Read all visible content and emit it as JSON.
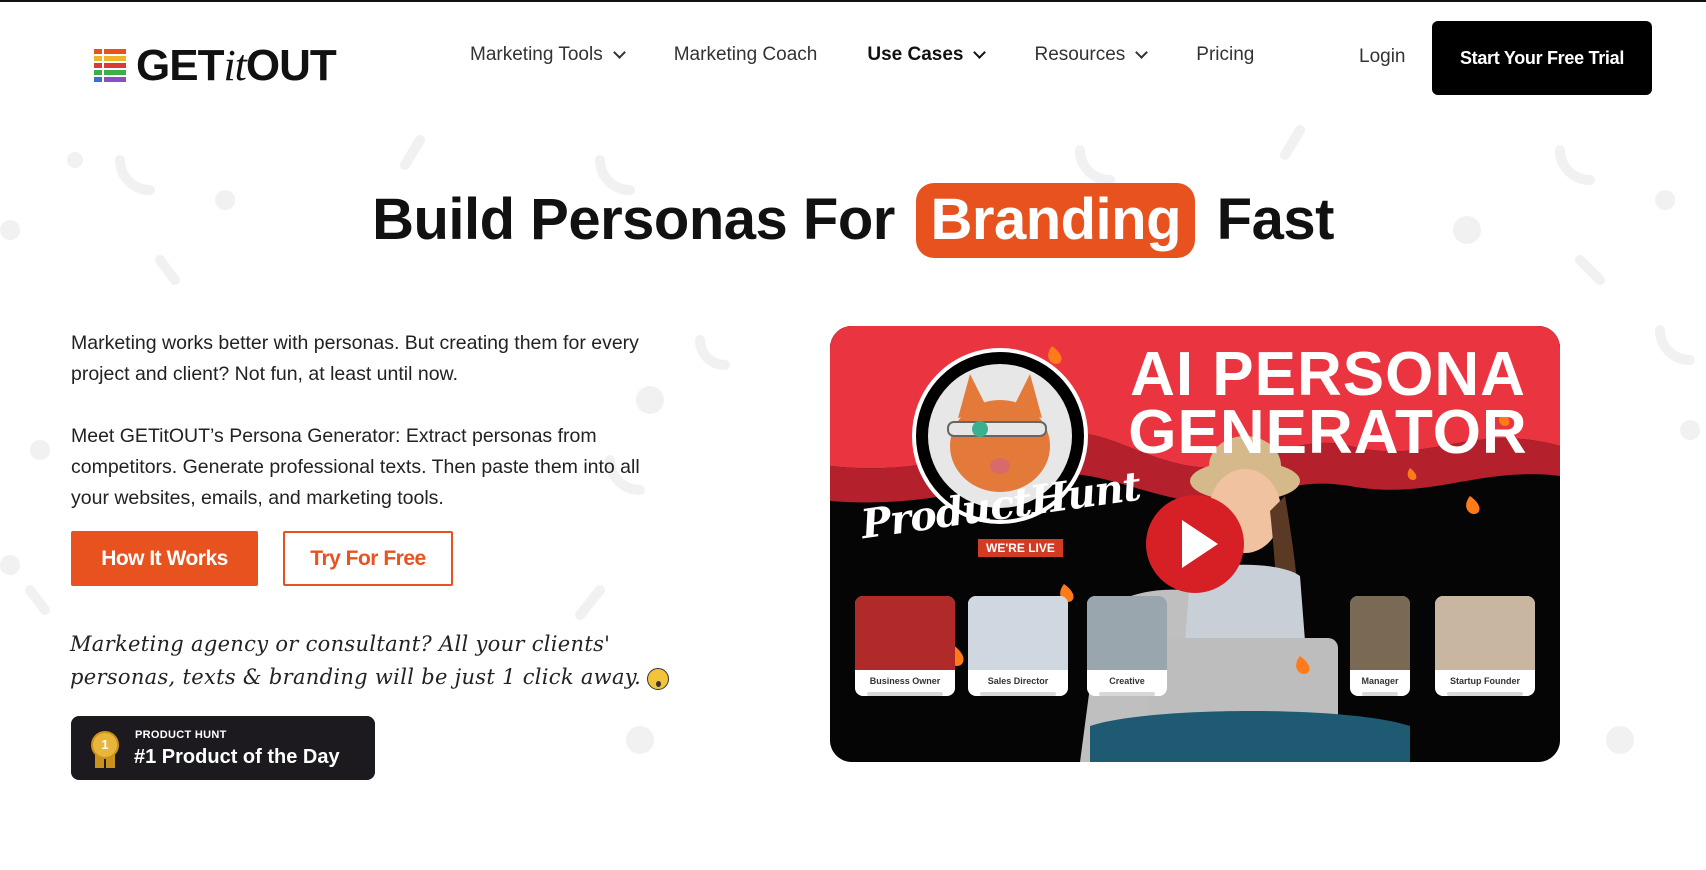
{
  "header": {
    "logo_text_a": "GET",
    "logo_text_it": "it",
    "logo_text_b": "OUT",
    "nav": [
      {
        "label": "Marketing Tools",
        "has_dropdown": true,
        "active": false
      },
      {
        "label": "Marketing Coach",
        "has_dropdown": false,
        "active": false
      },
      {
        "label": "Use Cases",
        "has_dropdown": true,
        "active": true
      },
      {
        "label": "Resources",
        "has_dropdown": true,
        "active": false
      },
      {
        "label": "Pricing",
        "has_dropdown": false,
        "active": false
      }
    ],
    "login_label": "Login",
    "cta_label": "Start Your Free Trial"
  },
  "hero": {
    "title_before": "Build Personas For",
    "title_highlight": "Branding",
    "title_after": "Fast",
    "paragraph_1": "Marketing works better with personas. But creating them for every project and client? Not fun, at least until now.",
    "paragraph_2": "Meet GETitOUT’s Persona Generator: Extract personas from competitors. Generate professional texts. Then paste them into all your websites, emails, and marketing tools.",
    "primary_button": "How It Works",
    "secondary_button": "Try For Free",
    "handwritten_note": "Marketing agency or consultant? All your clients' personas, texts & branding will be just 1 click away.",
    "badge": {
      "kicker": "PRODUCT HUNT",
      "title": "#1 Product of the Day",
      "medal_number": "1"
    }
  },
  "video": {
    "title_line_1": "AI PERSONA",
    "title_line_2": "GENERATOR",
    "product_hunt_script": "ProductHunt",
    "live_tag": "WE'RE LIVE",
    "persona_cards": [
      "Business Owner",
      "Sales Director",
      "Creative",
      "Manager",
      "Startup Founder"
    ]
  },
  "colors": {
    "accent": "#e8521f",
    "dark": "#111111",
    "video_red": "#e8303a",
    "video_dark_red": "#b01e2a"
  },
  "icons": {
    "logo_mark": "striped-square-logo-icon",
    "dropdown": "chevron-down-icon",
    "play": "play-icon",
    "medal": "medal-icon",
    "emoji": "exploding-head-emoji-icon"
  }
}
